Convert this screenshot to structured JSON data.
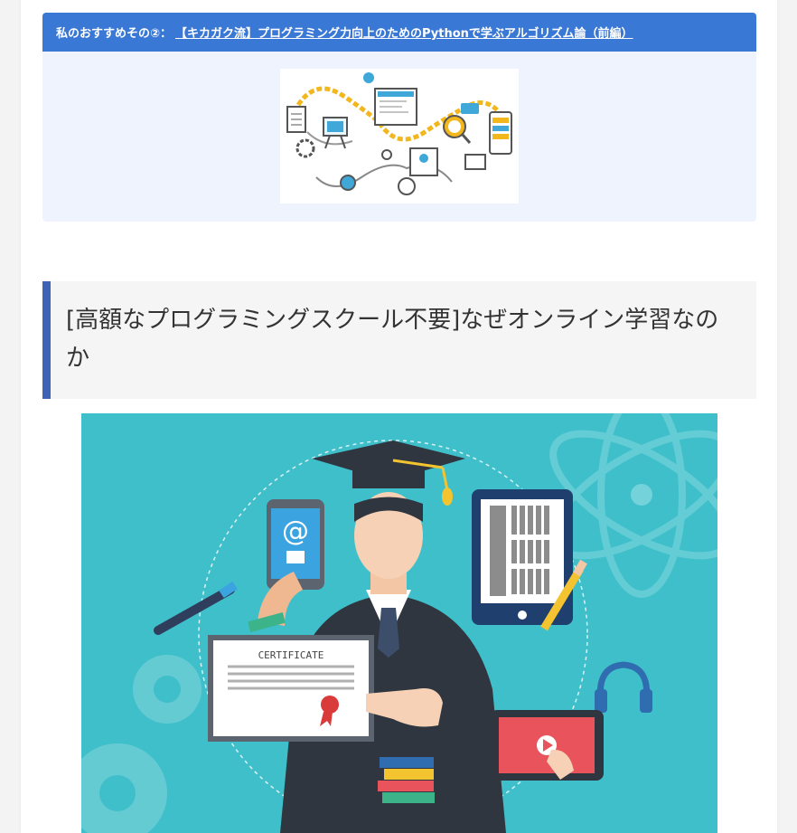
{
  "recommend": {
    "prefix": "私のおすすめその②：",
    "link_text": "【キカガク流】プログラミング力向上のためのPythonで学ぶアルゴリズム論（前編）"
  },
  "section": {
    "heading": "[高額なプログラミングスクール不要]なぜオンライン学習なのか"
  },
  "hero": {
    "certificate_text": "CERTIFICATE",
    "phone_symbol": "@"
  },
  "colors": {
    "accent_blue": "#3a78d6",
    "heading_border": "#3e62b5",
    "hero_bg": "#3fbfca"
  }
}
